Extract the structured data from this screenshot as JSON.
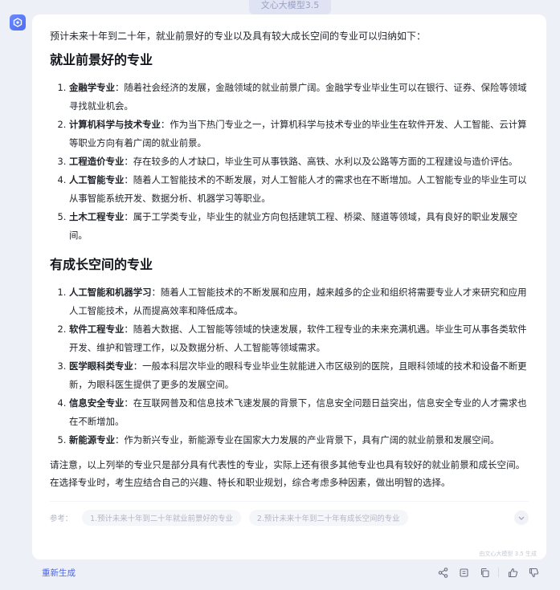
{
  "model_tag": "文心大模型3.5",
  "answer": {
    "intro": "预计未来十年到二十年，就业前景好的专业以及具有较大成长空间的专业可以归纳如下：",
    "section1": {
      "heading": "就业前景好的专业",
      "items": [
        {
          "term": "金融学专业",
          "text": "：随着社会经济的发展，金融领域的就业前景广阔。金融学专业毕业生可以在银行、证券、保险等领域寻找就业机会。"
        },
        {
          "term": "计算机科学与技术专业",
          "text": "：作为当下热门专业之一，计算机科学与技术专业的毕业生在软件开发、人工智能、云计算等职业方向有着广阔的就业前景。"
        },
        {
          "term": "工程造价专业",
          "text": "：存在较多的人才缺口，毕业生可从事铁路、高铁、水利以及公路等方面的工程建设与造价评估。"
        },
        {
          "term": "人工智能专业",
          "text": "：随着人工智能技术的不断发展，对人工智能人才的需求也在不断增加。人工智能专业的毕业生可以从事智能系统开发、数据分析、机器学习等职业。"
        },
        {
          "term": "土木工程专业",
          "text": "：属于工学类专业，毕业生的就业方向包括建筑工程、桥梁、隧道等领域，具有良好的职业发展空间。"
        }
      ]
    },
    "section2": {
      "heading": "有成长空间的专业",
      "items": [
        {
          "term": "人工智能和机器学习",
          "text": "：随着人工智能技术的不断发展和应用，越来越多的企业和组织将需要专业人才来研究和应用人工智能技术，从而提高效率和降低成本。"
        },
        {
          "term": "软件工程专业",
          "text": "：随着大数据、人工智能等领域的快速发展，软件工程专业的未来充满机遇。毕业生可从事各类软件开发、维护和管理工作，以及数据分析、人工智能等领域需求。"
        },
        {
          "term": "医学眼科类专业",
          "text": "：一般本科层次毕业的眼科专业毕业生就能进入市区级别的医院，且眼科领域的技术和设备不断更新，为眼科医生提供了更多的发展空间。"
        },
        {
          "term": "信息安全专业",
          "text": "：在互联网普及和信息技术飞速发展的背景下，信息安全问题日益突出，信息安全专业的人才需求也在不断增加。"
        },
        {
          "term": "新能源专业",
          "text": "：作为新兴专业，新能源专业在国家大力发展的产业背景下，具有广阔的就业前景和发展空间。"
        }
      ]
    },
    "closing": "请注意，以上列举的专业只是部分具有代表性的专业，实际上还有很多其他专业也具有较好的就业前景和成长空间。在选择专业时，考生应结合自己的兴趣、特长和职业规划，综合考虑多种因素，做出明智的选择。"
  },
  "references": {
    "label": "参考：",
    "items": [
      "1.预计未来十年到二十年就业前景好的专业",
      "2.预计未来十年到二十年有成长空间的专业"
    ]
  },
  "generated_note": "由文心大模型 3.5 生成",
  "footer": {
    "regenerate_label": "重新生成"
  },
  "icons": [
    "ernie-logo-icon",
    "chevron-down-icon",
    "share-icon",
    "copy-icon",
    "duplicate-icon",
    "thumbs-up-icon",
    "thumbs-down-icon"
  ]
}
